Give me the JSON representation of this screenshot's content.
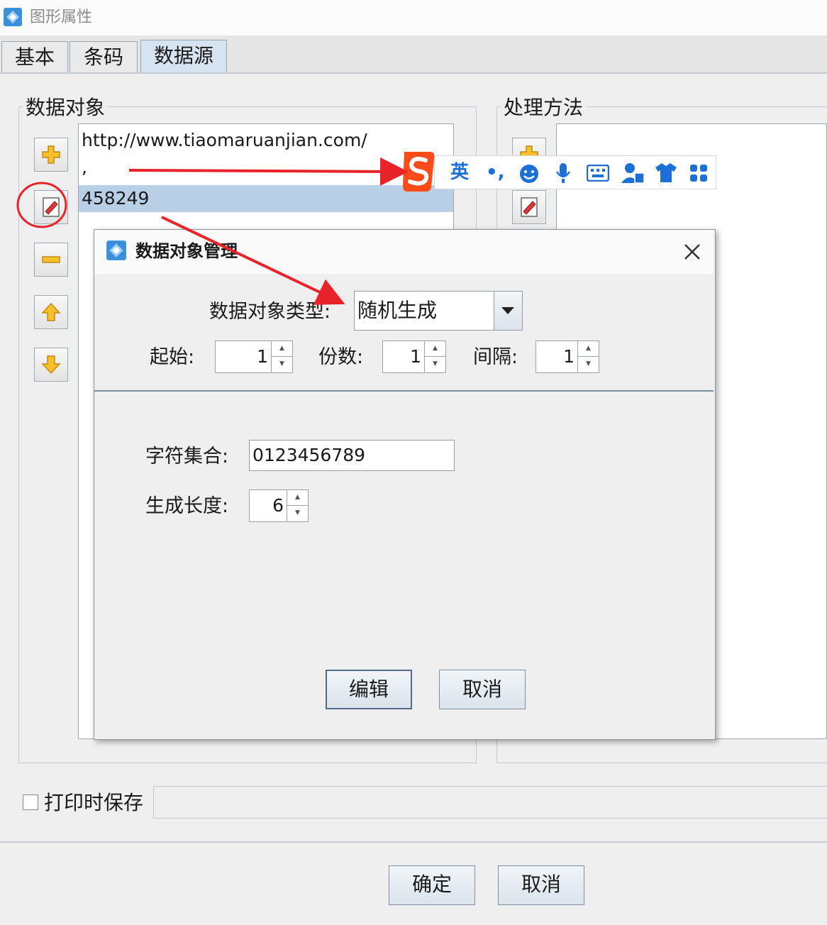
{
  "window": {
    "title": "图形属性"
  },
  "tabs": [
    {
      "label": "基本"
    },
    {
      "label": "条码"
    },
    {
      "label": "数据源"
    }
  ],
  "data_objects": {
    "label": "数据对象",
    "items": [
      "http://www.tiaomaruanjian.com/",
      ",",
      "458249"
    ],
    "selected_index": 2
  },
  "processing": {
    "label": "处理方法"
  },
  "ime_toolbar": {
    "lang_label": "英",
    "punct_label": "•,"
  },
  "dialog": {
    "title": "数据对象管理",
    "type_label": "数据对象类型:",
    "type_value": "随机生成",
    "start_label": "起始:",
    "start_value": "1",
    "copies_label": "份数:",
    "copies_value": "1",
    "interval_label": "间隔:",
    "interval_value": "1",
    "charset_label": "字符集合:",
    "charset_value": "0123456789",
    "length_label": "生成长度:",
    "length_value": "6",
    "edit_button": "编辑",
    "cancel_button": "取消"
  },
  "footer": {
    "save_on_print_label": "打印时保存",
    "ok_button": "确定",
    "cancel_button": "取消"
  },
  "colors": {
    "accent": "#1d6fd8",
    "annotation_red": "#e8232a",
    "selection": "#b9cfe6"
  }
}
